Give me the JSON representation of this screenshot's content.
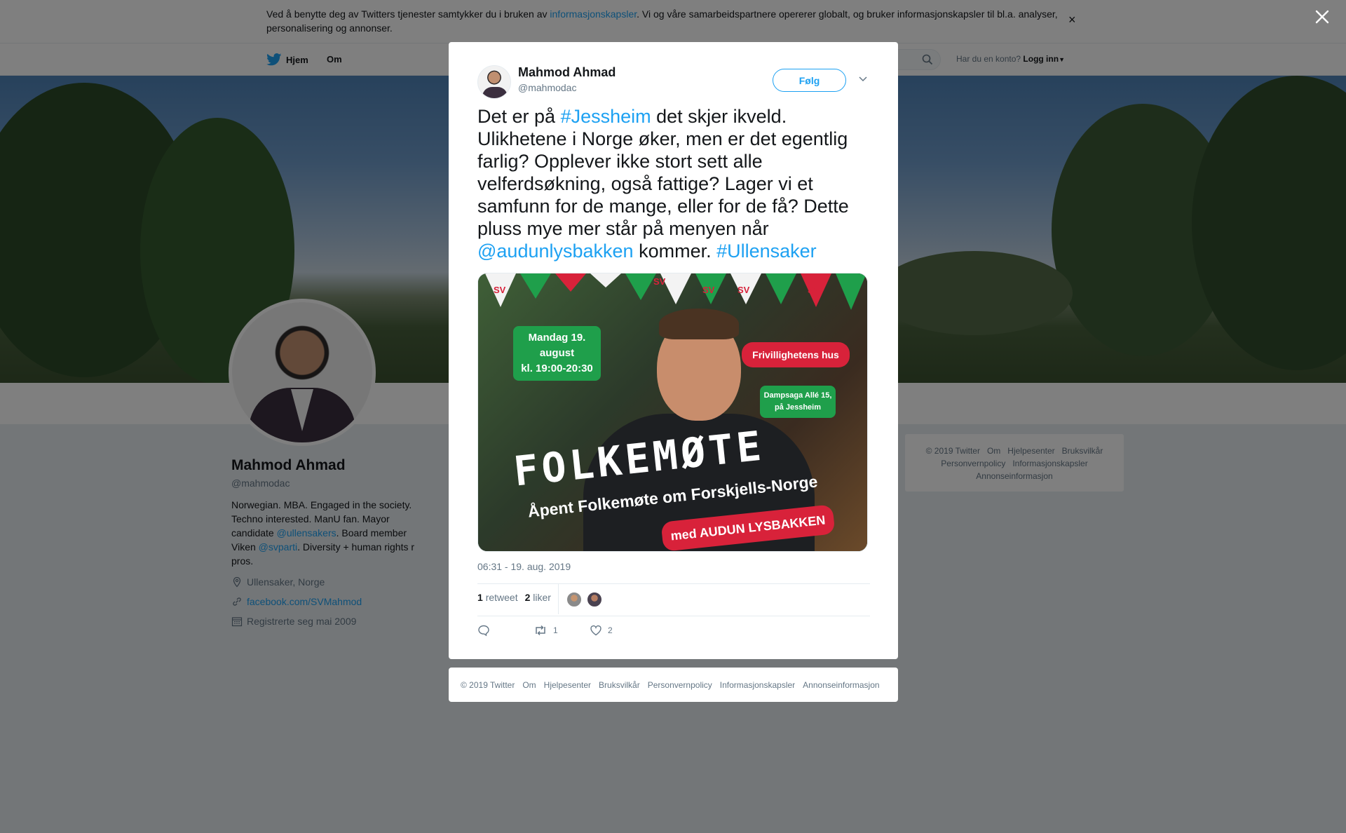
{
  "cookie_bar": {
    "text_before": "Ved å benytte deg av Twitters tjenester samtykker du i bruken av ",
    "link": "informasjonskapsler",
    "text_after": ". Vi og våre samarbeidspartnere opererer globalt, og bruker informasjonskapsler til bl.a. analyser, personalisering og annonser.",
    "close": "×"
  },
  "nav": {
    "home": "Hjem",
    "about": "Om",
    "login_prompt": "Har du en konto?",
    "login": "Logg inn"
  },
  "profile": {
    "name": "Mahmod Ahmad",
    "handle": "@mahmodac",
    "bio_1": "Norwegian. MBA. Engaged in the society. Techno interested. ManU fan. Mayor candidate ",
    "bio_mention_1": "@ullensakers",
    "bio_2": ". Board member Viken ",
    "bio_mention_2": "@svparti",
    "bio_3": ". Diversity + human rights r pros.",
    "location": "Ullensaker, Norge",
    "website": "facebook.com/SVMahmod",
    "joined": "Registrerte seg mai 2009"
  },
  "sidebar_footer": {
    "items": [
      "© 2019 Twitter",
      "Om",
      "Hjelpesenter",
      "Bruksvilkår",
      "Personvernpolicy",
      "Informasjonskapsler",
      "Annonseinformasjon"
    ]
  },
  "tweet": {
    "name": "Mahmod Ahmad",
    "handle": "@mahmodac",
    "follow": "Følg",
    "text_1": "Det er på ",
    "tag_1": "#Jessheim",
    "text_2": " det skjer ikveld. Ulikhetene i Norge øker, men er det egentlig farlig? Opplever ikke stort sett alle velferdsøkning, også fattige? Lager vi et samfunn for de mange, eller for de få? Dette pluss mye mer står på menyen når ",
    "mention": "@audunlysbakken",
    "text_3": " kommer. ",
    "tag_2": "#Ullensaker",
    "image": {
      "date_line_1": "Mandag 19. august",
      "date_line_2": "kl. 19:00-20:30",
      "venue": "Frivillighetens hus",
      "address_1": "Dampsaga Allé 15,",
      "address_2": "på Jessheim",
      "headline": "FOLKEMØTE",
      "subline": "Åpent Folkemøte om Forskjells-Norge",
      "speaker": "med AUDUN LYSBAKKEN",
      "party_mark": "SV"
    },
    "timestamp": "06:31 - 19. aug. 2019",
    "retweet_count": "1",
    "retweet_label": "retweet",
    "like_count": "2",
    "like_label": "liker",
    "action_retweets": "1",
    "action_likes": "2"
  },
  "modal_footer": {
    "items": [
      "© 2019 Twitter",
      "Om",
      "Hjelpesenter",
      "Bruksvilkår",
      "Personvernpolicy",
      "Informasjonskapsler",
      "Annonseinformasjon"
    ]
  },
  "colors": {
    "accent": "#1da1f2",
    "overlay": "rgba(0,0,0,0.5)"
  }
}
